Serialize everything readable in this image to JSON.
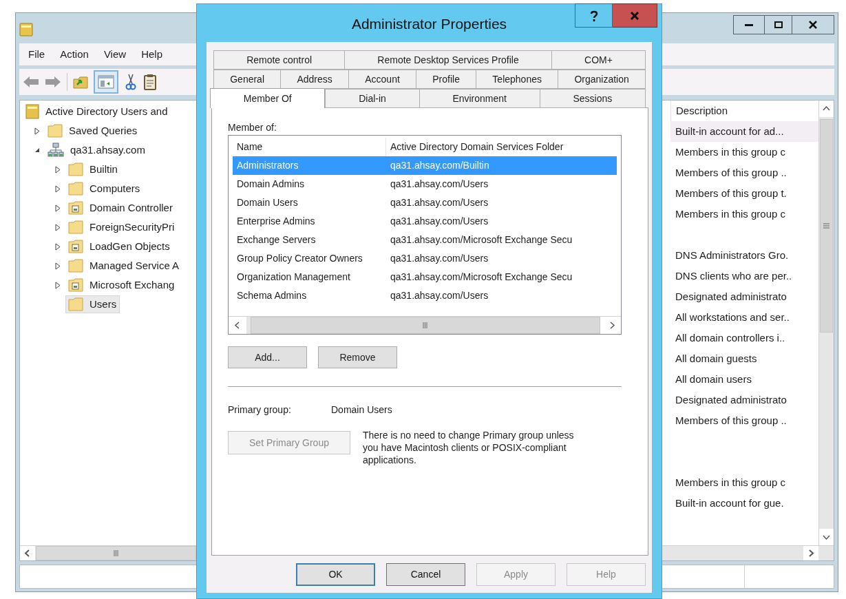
{
  "main_window": {
    "menu": [
      "File",
      "Action",
      "View",
      "Help"
    ],
    "console_tree_toggle": {
      "pressed": true
    },
    "tree": [
      {
        "label": "Active Directory Users and",
        "kind": "snapin",
        "children": [
          {
            "label": "Saved Queries",
            "kind": "folder",
            "expanded": false,
            "selected": false
          },
          {
            "label": "qa31.ahsay.com",
            "kind": "domain",
            "expanded": true,
            "selected": false,
            "children": [
              {
                "label": "Builtin",
                "kind": "folder",
                "expanded": false,
                "selected": false
              },
              {
                "label": "Computers",
                "kind": "folder",
                "expanded": false,
                "selected": false
              },
              {
                "label": "Domain Controller",
                "kind": "ou",
                "expanded": false,
                "selected": false
              },
              {
                "label": "ForeignSecurityPri",
                "kind": "folder",
                "expanded": false,
                "selected": false
              },
              {
                "label": "LoadGen Objects",
                "kind": "ou",
                "expanded": false,
                "selected": false
              },
              {
                "label": "Managed Service A",
                "kind": "folder",
                "expanded": false,
                "selected": false
              },
              {
                "label": "Microsoft Exchang",
                "kind": "ou",
                "expanded": false,
                "selected": false
              },
              {
                "label": "Users",
                "kind": "folder",
                "selected": true
              }
            ]
          }
        ]
      }
    ],
    "list": {
      "column": "Description",
      "rows": [
        {
          "kind": "text",
          "description": "Built-in account for ad...",
          "selected": true
        },
        {
          "kind": "text",
          "description": "Members in this group c",
          "selected": false
        },
        {
          "kind": "text",
          "description": "Members of this group ..",
          "selected": false
        },
        {
          "kind": "text",
          "description": "Members of this group t.",
          "selected": false
        },
        {
          "kind": "text",
          "description": "Members in this group c",
          "selected": false
        },
        {
          "kind": "empty"
        },
        {
          "kind": "text",
          "description": "DNS Administrators Gro.",
          "selected": false
        },
        {
          "kind": "text",
          "description": "DNS clients who are per..",
          "selected": false
        },
        {
          "kind": "text",
          "description": "Designated administrato",
          "selected": false
        },
        {
          "kind": "text",
          "description": "All workstations and ser..",
          "selected": false
        },
        {
          "kind": "text",
          "description": "All domain controllers i..",
          "selected": false
        },
        {
          "kind": "text",
          "description": "All domain guests",
          "selected": false
        },
        {
          "kind": "text",
          "description": "All domain users",
          "selected": false
        },
        {
          "kind": "text",
          "description": "Designated administrato",
          "selected": false
        },
        {
          "kind": "text",
          "description": "Members of this group ..",
          "selected": false
        },
        {
          "kind": "empty"
        },
        {
          "kind": "empty"
        },
        {
          "kind": "text",
          "description": "Members in this group c",
          "selected": false
        },
        {
          "kind": "text",
          "description": "Built-in account for gue.",
          "selected": false
        }
      ]
    }
  },
  "dialog": {
    "title": "Administrator Properties",
    "tab_rows": [
      [
        {
          "label": "Remote control",
          "selected": false
        },
        {
          "label": "Remote Desktop Services Profile",
          "selected": false
        },
        {
          "label": "COM+",
          "selected": false
        }
      ],
      [
        {
          "label": "General",
          "selected": false
        },
        {
          "label": "Address",
          "selected": false
        },
        {
          "label": "Account",
          "selected": false
        },
        {
          "label": "Profile",
          "selected": false
        },
        {
          "label": "Telephones",
          "selected": false
        },
        {
          "label": "Organization",
          "selected": false
        }
      ],
      [
        {
          "label": "Member Of",
          "selected": true
        },
        {
          "label": "Dial-in",
          "selected": false
        },
        {
          "label": "Environment",
          "selected": false
        },
        {
          "label": "Sessions",
          "selected": false
        }
      ]
    ],
    "member_of_label": "Member of:",
    "members": {
      "columns": [
        "Name",
        "Active Directory Domain Services Folder"
      ],
      "rows": [
        {
          "name": "Administrators",
          "folder": "qa31.ahsay.com/Builtin",
          "selected": true
        },
        {
          "name": "Domain Admins",
          "folder": "qa31.ahsay.com/Users",
          "selected": false
        },
        {
          "name": "Domain Users",
          "folder": "qa31.ahsay.com/Users",
          "selected": false
        },
        {
          "name": "Enterprise Admins",
          "folder": "qa31.ahsay.com/Users",
          "selected": false
        },
        {
          "name": "Exchange Servers",
          "folder": "qa31.ahsay.com/Microsoft Exchange Secu",
          "selected": false
        },
        {
          "name": "Group Policy Creator Owners",
          "folder": "qa31.ahsay.com/Users",
          "selected": false
        },
        {
          "name": "Organization Management",
          "folder": "qa31.ahsay.com/Microsoft Exchange Secu",
          "selected": false
        },
        {
          "name": "Schema Admins",
          "folder": "qa31.ahsay.com/Users",
          "selected": false
        }
      ]
    },
    "list_buttons": [
      "Add...",
      "Remove"
    ],
    "primary_group_label": "Primary group:",
    "primary_group_value": "Domain Users",
    "set_primary_button": {
      "label": "Set Primary Group",
      "disabled": true
    },
    "note": "There is no need to change Primary group unless you have Macintosh clients or POSIX-compliant applications.",
    "footer_buttons": [
      {
        "label": "OK",
        "default": true,
        "disabled": false
      },
      {
        "label": "Cancel",
        "default": false,
        "disabled": false
      },
      {
        "label": "Apply",
        "default": false,
        "disabled": true
      },
      {
        "label": "Help",
        "default": false,
        "disabled": true
      }
    ]
  }
}
